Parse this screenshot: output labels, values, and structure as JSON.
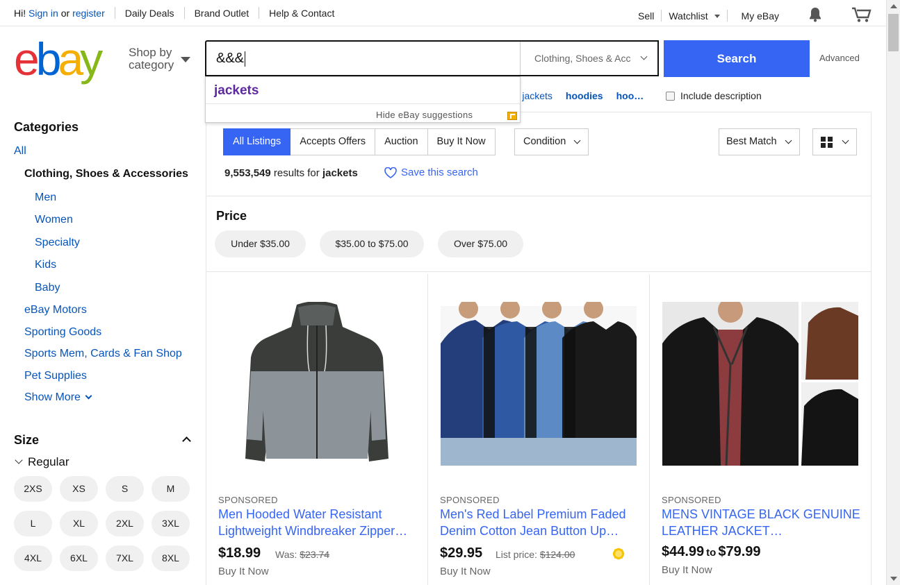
{
  "topbar": {
    "greeting": "Hi!",
    "sign_in": "Sign in",
    "or": "or",
    "register": "register",
    "daily_deals": "Daily Deals",
    "brand_outlet": "Brand Outlet",
    "help_contact": "Help & Contact",
    "sell": "Sell",
    "watchlist": "Watchlist",
    "my_ebay": "My eBay"
  },
  "header": {
    "logo_letters": [
      "e",
      "b",
      "a",
      "y"
    ],
    "logo_colors": [
      "#e53238",
      "#0064d2",
      "#f5af02",
      "#86b817"
    ],
    "shop_by": "Shop by",
    "category": "category",
    "search_value": "&&&",
    "category_select": "Clothing, Shoes & Acc",
    "search_button": "Search",
    "advanced": "Advanced"
  },
  "dropdown": {
    "suggestion": "jackets",
    "hide_label": "Hide eBay suggestions"
  },
  "related": {
    "items": [
      "er jackets",
      "hoodies",
      "hoo…"
    ],
    "include_description": "Include description"
  },
  "sidebar": {
    "categories_title": "Categories",
    "all": "All",
    "selected_category": "Clothing, Shoes & Accessories",
    "subcategories": [
      "Men",
      "Women",
      "Specialty",
      "Kids",
      "Baby"
    ],
    "other_categories": [
      "eBay Motors",
      "Sporting Goods",
      "Sports Mem, Cards & Fan Shop",
      "Pet Supplies"
    ],
    "show_more": "Show More",
    "size_title": "Size",
    "regular": "Regular",
    "sizes": [
      "2XS",
      "XS",
      "S",
      "M",
      "L",
      "XL",
      "2XL",
      "3XL",
      "4XL",
      "6XL",
      "7XL",
      "8XL"
    ]
  },
  "main": {
    "tabs": [
      "All Listings",
      "Accepts Offers",
      "Auction",
      "Buy It Now"
    ],
    "condition": "Condition",
    "sort": "Best Match",
    "result_count": "9,553,549",
    "results_for": "results for",
    "query": "jackets",
    "save_search": "Save this search",
    "price_title": "Price",
    "price_chips": [
      "Under $35.00",
      "$35.00 to $75.00",
      "Over $75.00"
    ]
  },
  "listings": [
    {
      "sponsored": "SPONSORED",
      "title": "Men Hooded Water Resistant Lightweight Windbreaker Zipper…",
      "price": "$18.99",
      "was_label": "Was:",
      "was_price": "$23.74",
      "format": "Buy It Now"
    },
    {
      "sponsored": "SPONSORED",
      "title": "Men's Red Label Premium Faded Denim Cotton Jean Button Up…",
      "price": "$29.95",
      "was_label": "List price:",
      "was_price": "$124.00",
      "format": "Buy It Now"
    },
    {
      "sponsored": "SPONSORED",
      "title": "MENS VINTAGE BLACK GENUINE LEATHER JACKET…",
      "price_low": "$44.99",
      "to": "to",
      "price_high": "$79.99",
      "format": "Buy It Now"
    }
  ],
  "colors": {
    "link": "#0654ba",
    "accent": "#3665f3",
    "visited": "#5d2a9e"
  }
}
